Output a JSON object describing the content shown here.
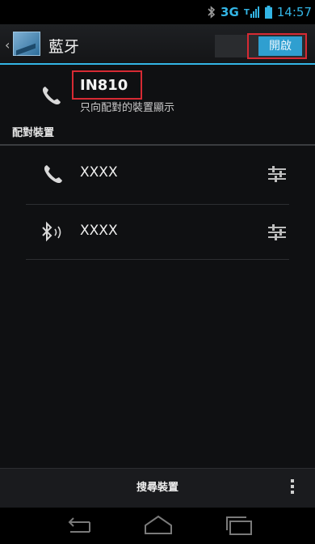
{
  "status_bar": {
    "bluetooth": "bluetooth-icon",
    "network": "3G",
    "signal": "signal-icon",
    "battery": "battery-icon",
    "time": "14:57"
  },
  "action_bar": {
    "title": "藍牙",
    "toggle_label": "開啟"
  },
  "own_device": {
    "name": "IN810",
    "subtitle": "只向配對的裝置顯示"
  },
  "paired_header": "配對裝置",
  "paired_devices": [
    {
      "icon": "phone-icon",
      "name": "XXXX"
    },
    {
      "icon": "bluetooth-icon",
      "name": "XXXX"
    }
  ],
  "bottom_bar": {
    "scan_label": "搜尋裝置"
  },
  "colors": {
    "accent": "#33b5e5",
    "highlight": "#d62a33"
  }
}
